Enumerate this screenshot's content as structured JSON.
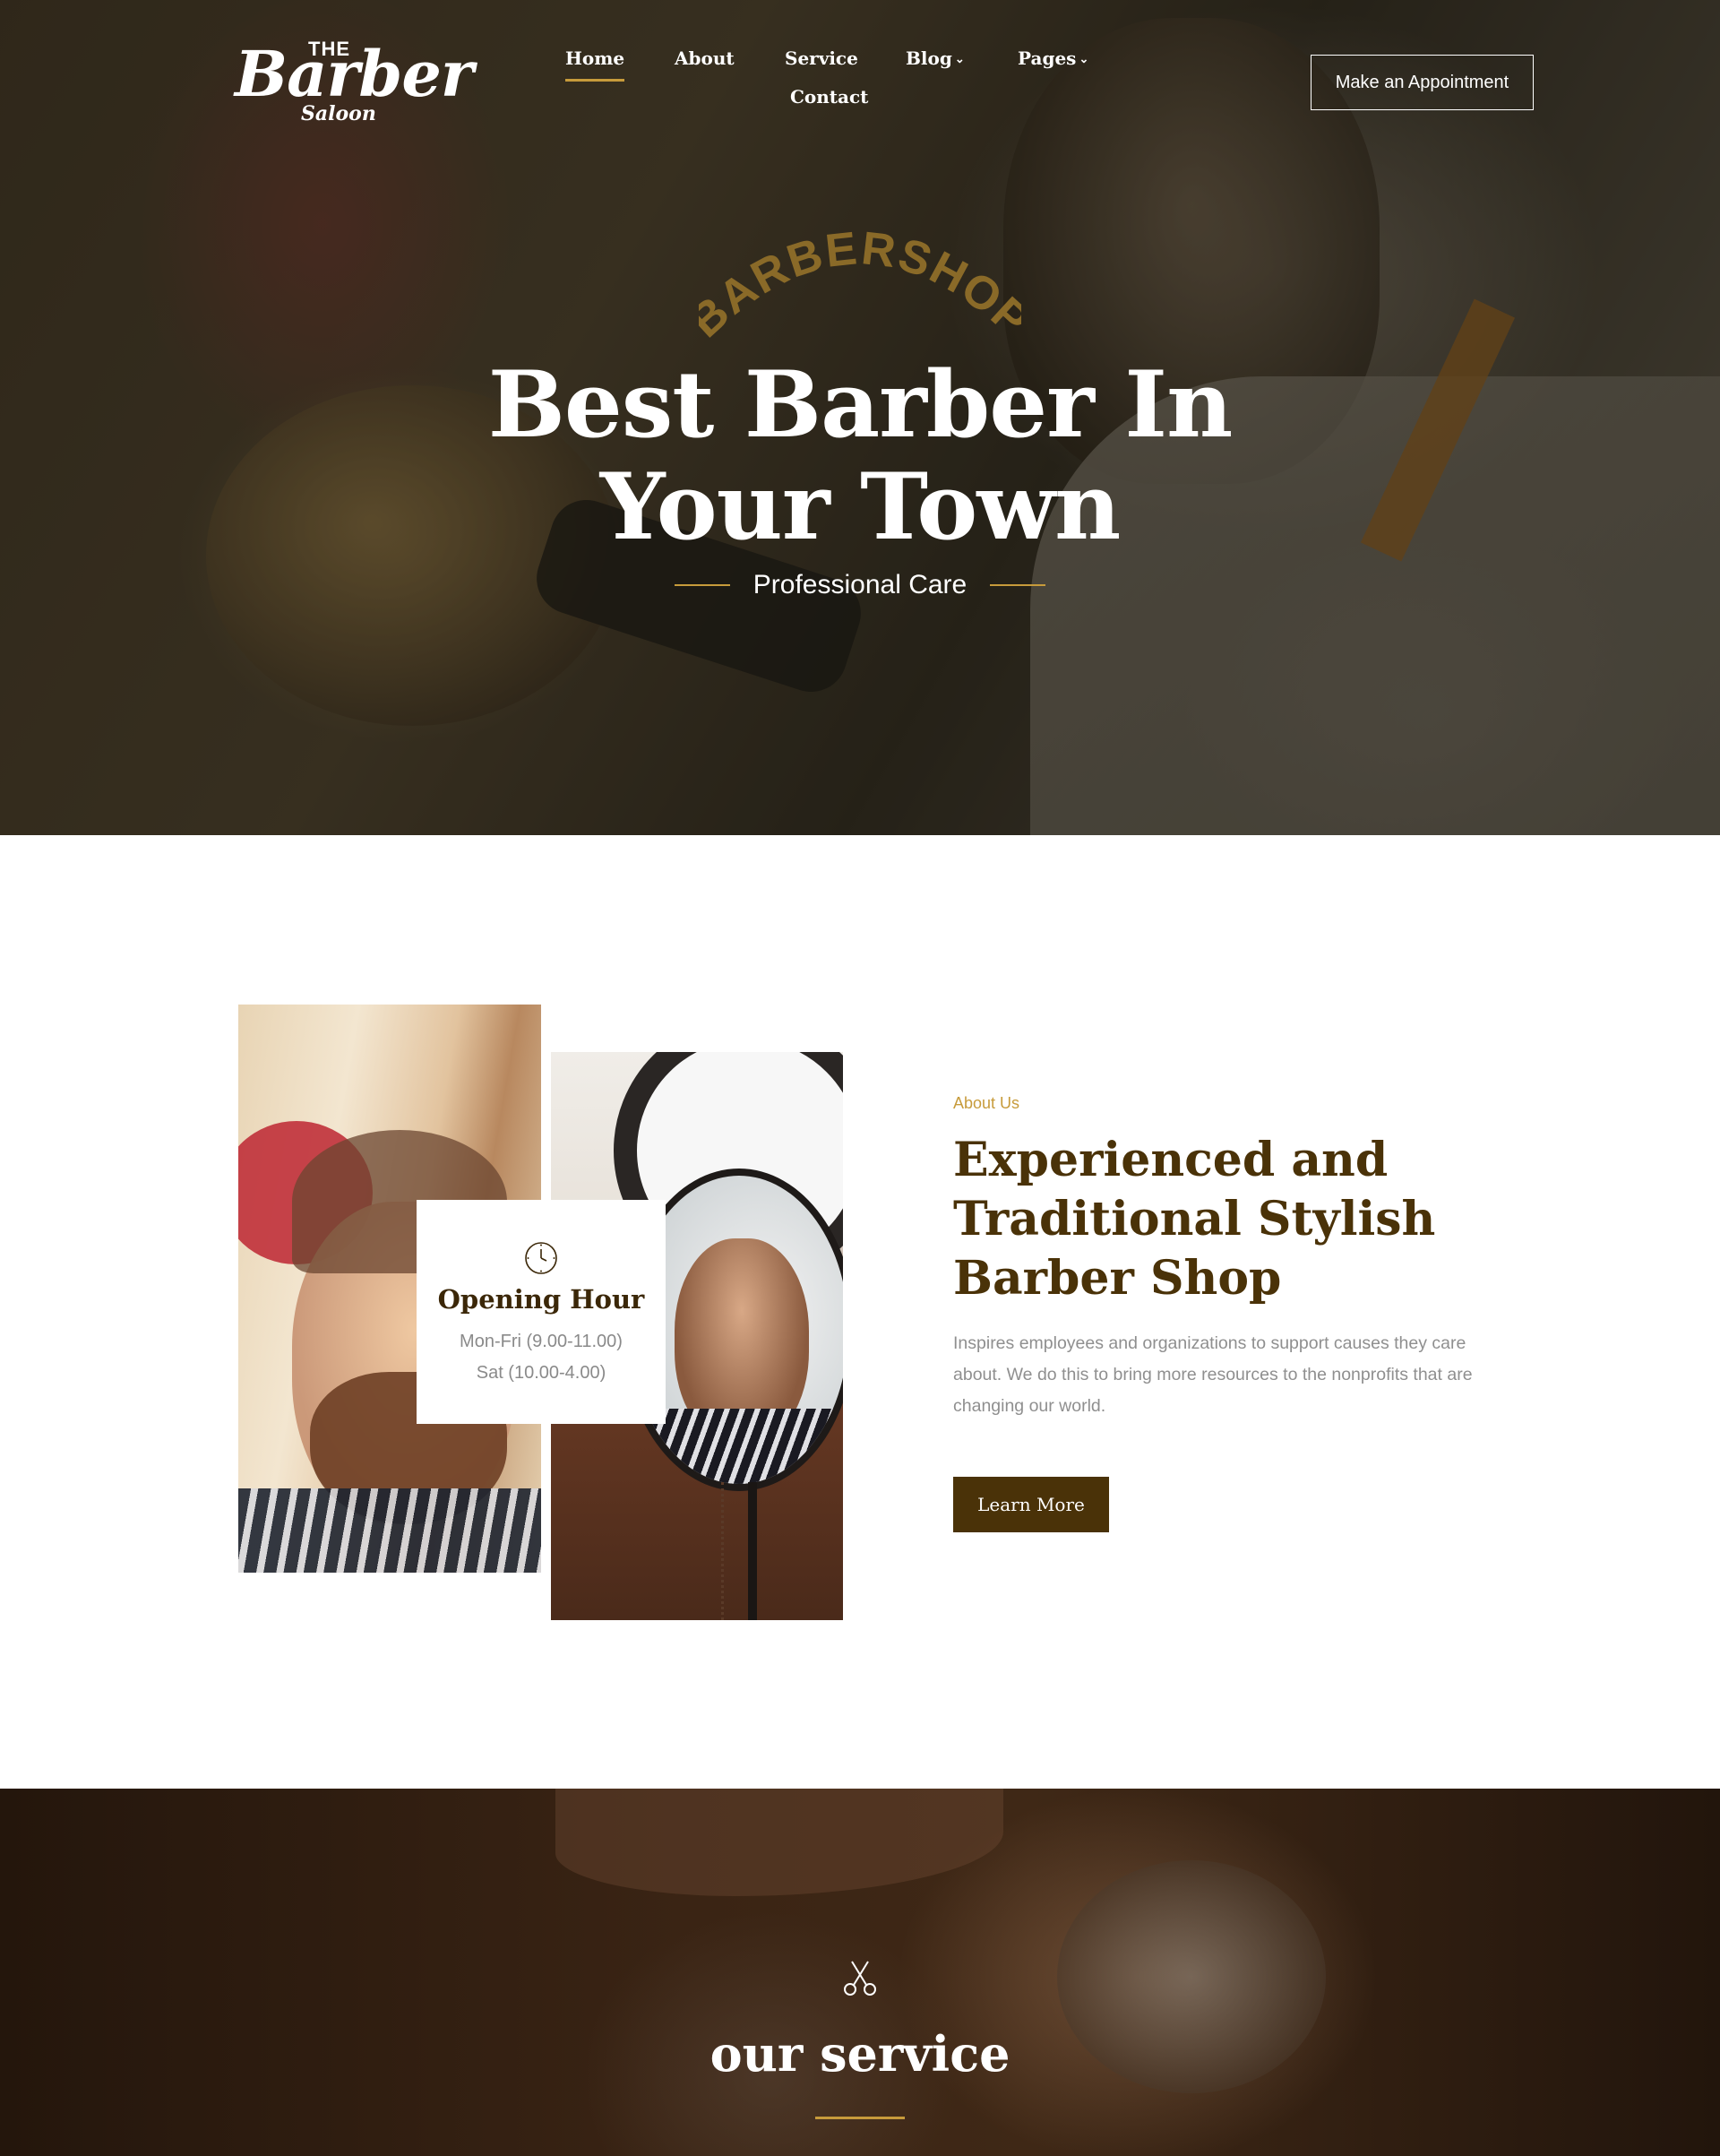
{
  "header": {
    "logo": {
      "top": "THE",
      "main": "Barber",
      "sub": "Saloon"
    },
    "nav": [
      {
        "label": "Home",
        "active": true,
        "dropdown": false
      },
      {
        "label": "About",
        "active": false,
        "dropdown": false
      },
      {
        "label": "Service",
        "active": false,
        "dropdown": false
      },
      {
        "label": "Blog",
        "active": false,
        "dropdown": true
      },
      {
        "label": "Pages",
        "active": false,
        "dropdown": true
      },
      {
        "label": "Contact",
        "active": false,
        "dropdown": false
      }
    ],
    "cta_label": "Make an Appointment"
  },
  "hero": {
    "arc_text": "BARBERSHOP",
    "title_line1": "Best Barber In",
    "title_line2": "Your Town",
    "subtitle": "Professional Care"
  },
  "about": {
    "hours_card": {
      "icon": "clock-icon",
      "title": "Opening Hour",
      "weekday": "Mon-Fri (9.00-11.00)",
      "saturday": "Sat (10.00-4.00)"
    },
    "label": "About Us",
    "heading_line1": "Experienced and",
    "heading_line2": "Traditional Stylish",
    "heading_line3": "Barber Shop",
    "text": "Inspires employees and organizations to support causes they care about. We do this to bring more resources to the nonprofits that are changing our world.",
    "button_label": "Learn More"
  },
  "service": {
    "icon": "scissors-icon",
    "title": "our service"
  },
  "colors": {
    "accent_gold": "#c79b3b",
    "brand_brown": "#4a3208",
    "body_gray": "#8f8f8f"
  }
}
